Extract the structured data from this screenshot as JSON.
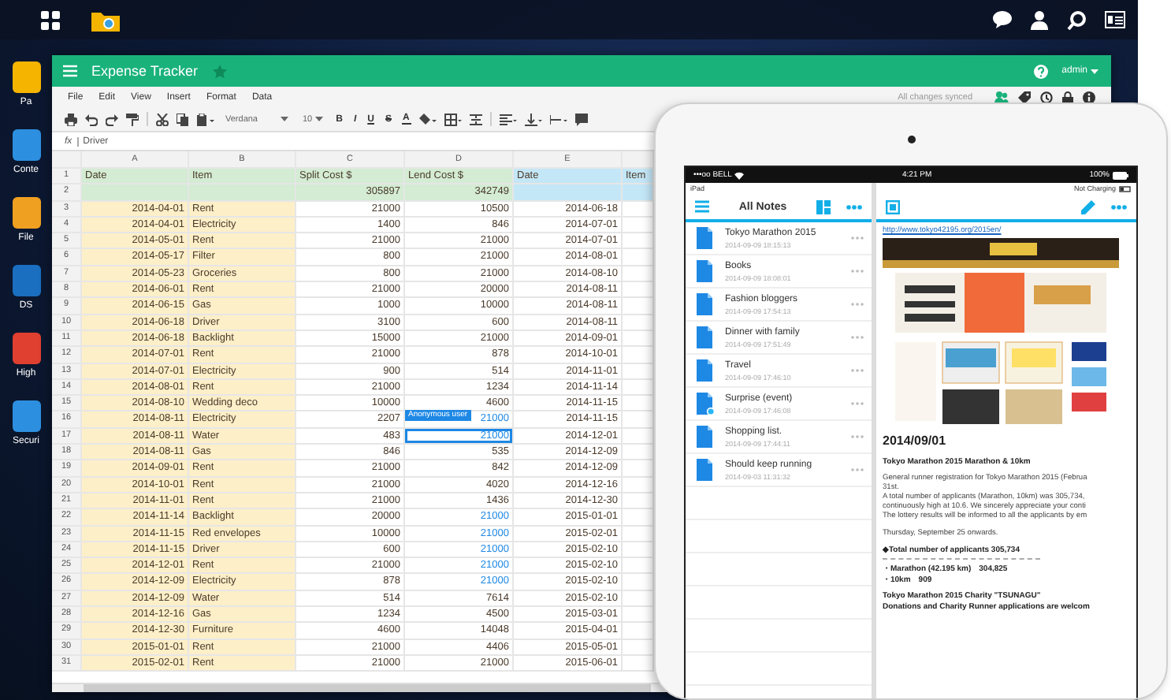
{
  "desktop": {
    "icons": [
      {
        "label": "Pa"
      },
      {
        "label": "Conte"
      },
      {
        "label": "File"
      },
      {
        "label": "DS"
      },
      {
        "label": "High"
      },
      {
        "label": "Securi"
      }
    ]
  },
  "spreadsheet": {
    "title": "Expense Tracker",
    "starred": false,
    "user": "admin",
    "menu": [
      "File",
      "Edit",
      "View",
      "Insert",
      "Format",
      "Data"
    ],
    "sync_status": "All changes synced",
    "toolbar": {
      "font": "Verdana",
      "size": "10",
      "styles": [
        "B",
        "I",
        "U",
        "S",
        "A"
      ]
    },
    "formula": {
      "label": "fx",
      "value": "Driver"
    },
    "columns": [
      "A",
      "B",
      "C",
      "D",
      "E"
    ],
    "header_row": {
      "number": "1",
      "labels": [
        "Date",
        "Item",
        "Split Cost $",
        "Lend Cost $",
        "Date",
        "Item"
      ]
    },
    "totals_row": {
      "number": "2",
      "split_total": "305897",
      "lend_total": "342749"
    },
    "rows": [
      {
        "number": "3",
        "date": "2014-04-01",
        "item": "Rent",
        "split": "21000",
        "lend": "10500",
        "date_2": "2014-06-18",
        "lend_edited": false,
        "selected": false
      },
      {
        "number": "4",
        "date": "2014-04-01",
        "item": "Electricity",
        "split": "1400",
        "lend": "846",
        "date_2": "2014-07-01",
        "lend_edited": false,
        "selected": false
      },
      {
        "number": "5",
        "date": "2014-05-01",
        "item": "Rent",
        "split": "21000",
        "lend": "21000",
        "date_2": "2014-07-01",
        "lend_edited": false,
        "selected": false
      },
      {
        "number": "6",
        "date": "2014-05-17",
        "item": "Filter",
        "split": "800",
        "lend": "21000",
        "date_2": "2014-08-01",
        "lend_edited": false,
        "selected": false
      },
      {
        "number": "7",
        "date": "2014-05-23",
        "item": "Groceries",
        "split": "800",
        "lend": "21000",
        "date_2": "2014-08-10",
        "lend_edited": false,
        "selected": false
      },
      {
        "number": "8",
        "date": "2014-06-01",
        "item": "Rent",
        "split": "21000",
        "lend": "20000",
        "date_2": "2014-08-11",
        "lend_edited": false,
        "selected": false
      },
      {
        "number": "9",
        "date": "2014-06-15",
        "item": "Gas",
        "split": "1000",
        "lend": "10000",
        "date_2": "2014-08-11",
        "lend_edited": false,
        "selected": false
      },
      {
        "number": "10",
        "date": "2014-06-18",
        "item": "Driver",
        "split": "3100",
        "lend": "600",
        "date_2": "2014-08-11",
        "lend_edited": false,
        "selected": false
      },
      {
        "number": "11",
        "date": "2014-06-18",
        "item": "Backlight",
        "split": "15000",
        "lend": "21000",
        "date_2": "2014-09-01",
        "lend_edited": false,
        "selected": false
      },
      {
        "number": "12",
        "date": "2014-07-01",
        "item": "Rent",
        "split": "21000",
        "lend": "878",
        "date_2": "2014-10-01",
        "lend_edited": false,
        "selected": false
      },
      {
        "number": "13",
        "date": "2014-07-01",
        "item": "Electricity",
        "split": "900",
        "lend": "514",
        "date_2": "2014-11-01",
        "lend_edited": false,
        "selected": false
      },
      {
        "number": "14",
        "date": "2014-08-01",
        "item": "Rent",
        "split": "21000",
        "lend": "1234",
        "date_2": "2014-11-14",
        "lend_edited": false,
        "selected": false
      },
      {
        "number": "15",
        "date": "2014-08-10",
        "item": "Wedding deco",
        "split": "10000",
        "lend": "4600",
        "date_2": "2014-11-15",
        "lend_edited": false,
        "selected": false
      },
      {
        "number": "16",
        "date": "2014-08-11",
        "item": "Electricity",
        "split": "2207",
        "lend": "21000",
        "date_2": "2014-11-15",
        "lend_edited": true,
        "selected": false,
        "editor_tag": "Anonymous user"
      },
      {
        "number": "17",
        "date": "2014-08-11",
        "item": "Water",
        "split": "483",
        "lend": "21000",
        "date_2": "2014-12-01",
        "lend_edited": true,
        "selected": true
      },
      {
        "number": "18",
        "date": "2014-08-11",
        "item": "Gas",
        "split": "846",
        "lend": "535",
        "date_2": "2014-12-09",
        "lend_edited": false,
        "selected": false
      },
      {
        "number": "19",
        "date": "2014-09-01",
        "item": "Rent",
        "split": "21000",
        "lend": "842",
        "date_2": "2014-12-09",
        "lend_edited": false,
        "selected": false
      },
      {
        "number": "20",
        "date": "2014-10-01",
        "item": "Rent",
        "split": "21000",
        "lend": "4020",
        "date_2": "2014-12-16",
        "lend_edited": false,
        "selected": false
      },
      {
        "number": "21",
        "date": "2014-11-01",
        "item": "Rent",
        "split": "21000",
        "lend": "1436",
        "date_2": "2014-12-30",
        "lend_edited": false,
        "selected": false
      },
      {
        "number": "22",
        "date": "2014-11-14",
        "item": "Backlight",
        "split": "20000",
        "lend": "21000",
        "date_2": "2015-01-01",
        "lend_edited": true,
        "selected": false
      },
      {
        "number": "23",
        "date": "2014-11-15",
        "item": "Red envelopes",
        "split": "10000",
        "lend": "21000",
        "date_2": "2015-02-01",
        "lend_edited": true,
        "selected": false
      },
      {
        "number": "24",
        "date": "2014-11-15",
        "item": "Driver",
        "split": "600",
        "lend": "21000",
        "date_2": "2015-02-10",
        "lend_edited": true,
        "selected": false
      },
      {
        "number": "25",
        "date": "2014-12-01",
        "item": "Rent",
        "split": "21000",
        "lend": "21000",
        "date_2": "2015-02-10",
        "lend_edited": true,
        "selected": false
      },
      {
        "number": "26",
        "date": "2014-12-09",
        "item": "Electricity",
        "split": "878",
        "lend": "21000",
        "date_2": "2015-02-10",
        "lend_edited": true,
        "selected": false
      },
      {
        "number": "27",
        "date": "2014-12-09",
        "item": "Water",
        "split": "514",
        "lend": "7614",
        "date_2": "2015-02-10",
        "lend_edited": false,
        "selected": false
      },
      {
        "number": "28",
        "date": "2014-12-16",
        "item": "Gas",
        "split": "1234",
        "lend": "4500",
        "date_2": "2015-03-01",
        "lend_edited": false,
        "selected": false
      },
      {
        "number": "29",
        "date": "2014-12-30",
        "item": "Furniture",
        "split": "4600",
        "lend": "14048",
        "date_2": "2015-04-01",
        "lend_edited": false,
        "selected": false
      },
      {
        "number": "30",
        "date": "2015-01-01",
        "item": "Rent",
        "split": "21000",
        "lend": "4406",
        "date_2": "2015-05-01",
        "lend_edited": false,
        "selected": false
      },
      {
        "number": "31",
        "date": "2015-02-01",
        "item": "Rent",
        "split": "21000",
        "lend": "21000",
        "date_2": "2015-06-01",
        "lend_edited": false,
        "selected": false
      }
    ]
  },
  "tablet": {
    "status_bar": {
      "carrier": "•••oo BELL",
      "time": "4:21 PM",
      "battery": "100%"
    },
    "notes_pane": {
      "device": "iPad",
      "title": "All Notes",
      "notes": [
        {
          "title": "Tokyo Marathon 2015",
          "date": "2014-09-09 18:15:13",
          "shared": false
        },
        {
          "title": "Books",
          "date": "2014-09-09 18:08:01",
          "shared": false
        },
        {
          "title": "Fashion bloggers",
          "date": "2014-09-09 17:54:13",
          "shared": false
        },
        {
          "title": "Dinner with family",
          "date": "2014-09-09 17:51:49",
          "shared": false
        },
        {
          "title": "Travel",
          "date": "2014-09-09 17:46:10",
          "shared": false
        },
        {
          "title": "Surprise (event)",
          "date": "2014-09-09 17:46:08",
          "shared": true
        },
        {
          "title": "Shopping list.",
          "date": "2014-09-09 17:44:11",
          "shared": false
        },
        {
          "title": "Should keep running",
          "date": "2014-09-03 11:31:32",
          "shared": false
        }
      ]
    },
    "note_view": {
      "charging": "Not Charging",
      "link": "http://www.tokyo42195.org/2015en/",
      "blocks": [
        {
          "kind": "date",
          "lines": [
            "2014/09/01"
          ]
        },
        {
          "kind": "bold",
          "lines": [
            "Tokyo Marathon 2015 Marathon & 10km"
          ]
        },
        {
          "kind": "para",
          "lines": [
            "General runner registration for Tokyo Marathon 2015 (Februa",
            "31st.",
            "A total number of applicants (Marathon, 10km) was 305,734,",
            "continuously high at 10.6. We sincerely appreciate your conti",
            "The lottery results will be informed to all the applicants by em"
          ]
        },
        {
          "kind": "para",
          "lines": [
            "Thursday, September 25 onwards."
          ]
        },
        {
          "kind": "bold",
          "lines": [
            "◆Total number of applicants 305,734"
          ]
        },
        {
          "kind": "rule"
        },
        {
          "kind": "bold",
          "lines": [
            "・Marathon (42.195 km)　304,825",
            "・10km　909"
          ]
        },
        {
          "kind": "bold",
          "lines": [
            "Tokyo Marathon 2015 Charity \"TSUNAGU\"",
            "Donations and Charity Runner applications are welcom"
          ]
        }
      ]
    }
  }
}
